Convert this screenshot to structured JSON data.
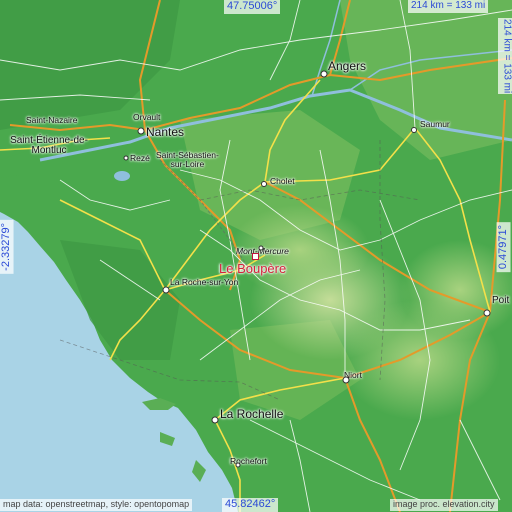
{
  "map": {
    "target": "Le Boupère",
    "cities": {
      "angers": "Angers",
      "nantes": "Nantes",
      "orvault": "Orvault",
      "saint_nazaire": "Saint-Nazaire",
      "saint_etienne": "Saint-Étienne-de-\nMontluc",
      "reze": "Rezé",
      "saint_sebastien": "Saint-Sébastien-\nsur-Loire",
      "cholet": "Cholet",
      "saumur": "Saumur",
      "mont_mercure": "Mont-Mercure",
      "la_roche": "La Roche-sur-Yon",
      "poitiers": "Poit",
      "niort": "Niort",
      "la_rochelle": "La Rochelle",
      "rochefort": "Rochefort"
    },
    "coords": {
      "top": "47.75006°",
      "bottom": "45.82462°",
      "left": "-2.33279°",
      "right": "0.47971°"
    },
    "scale_top": "214 km = 133 mi",
    "scale_right": "214 km = 133 mi",
    "credit_left": "map data: openstreetmap, style: opentopomap",
    "credit_right": "image proc. elevation.city",
    "colors": {
      "sea": "#a9d3e6",
      "lowland": "#43a64a",
      "midland": "#7cc063",
      "upland": "#b9d98e",
      "target": "#d5213c",
      "coord_text": "#2b4ad6"
    }
  }
}
